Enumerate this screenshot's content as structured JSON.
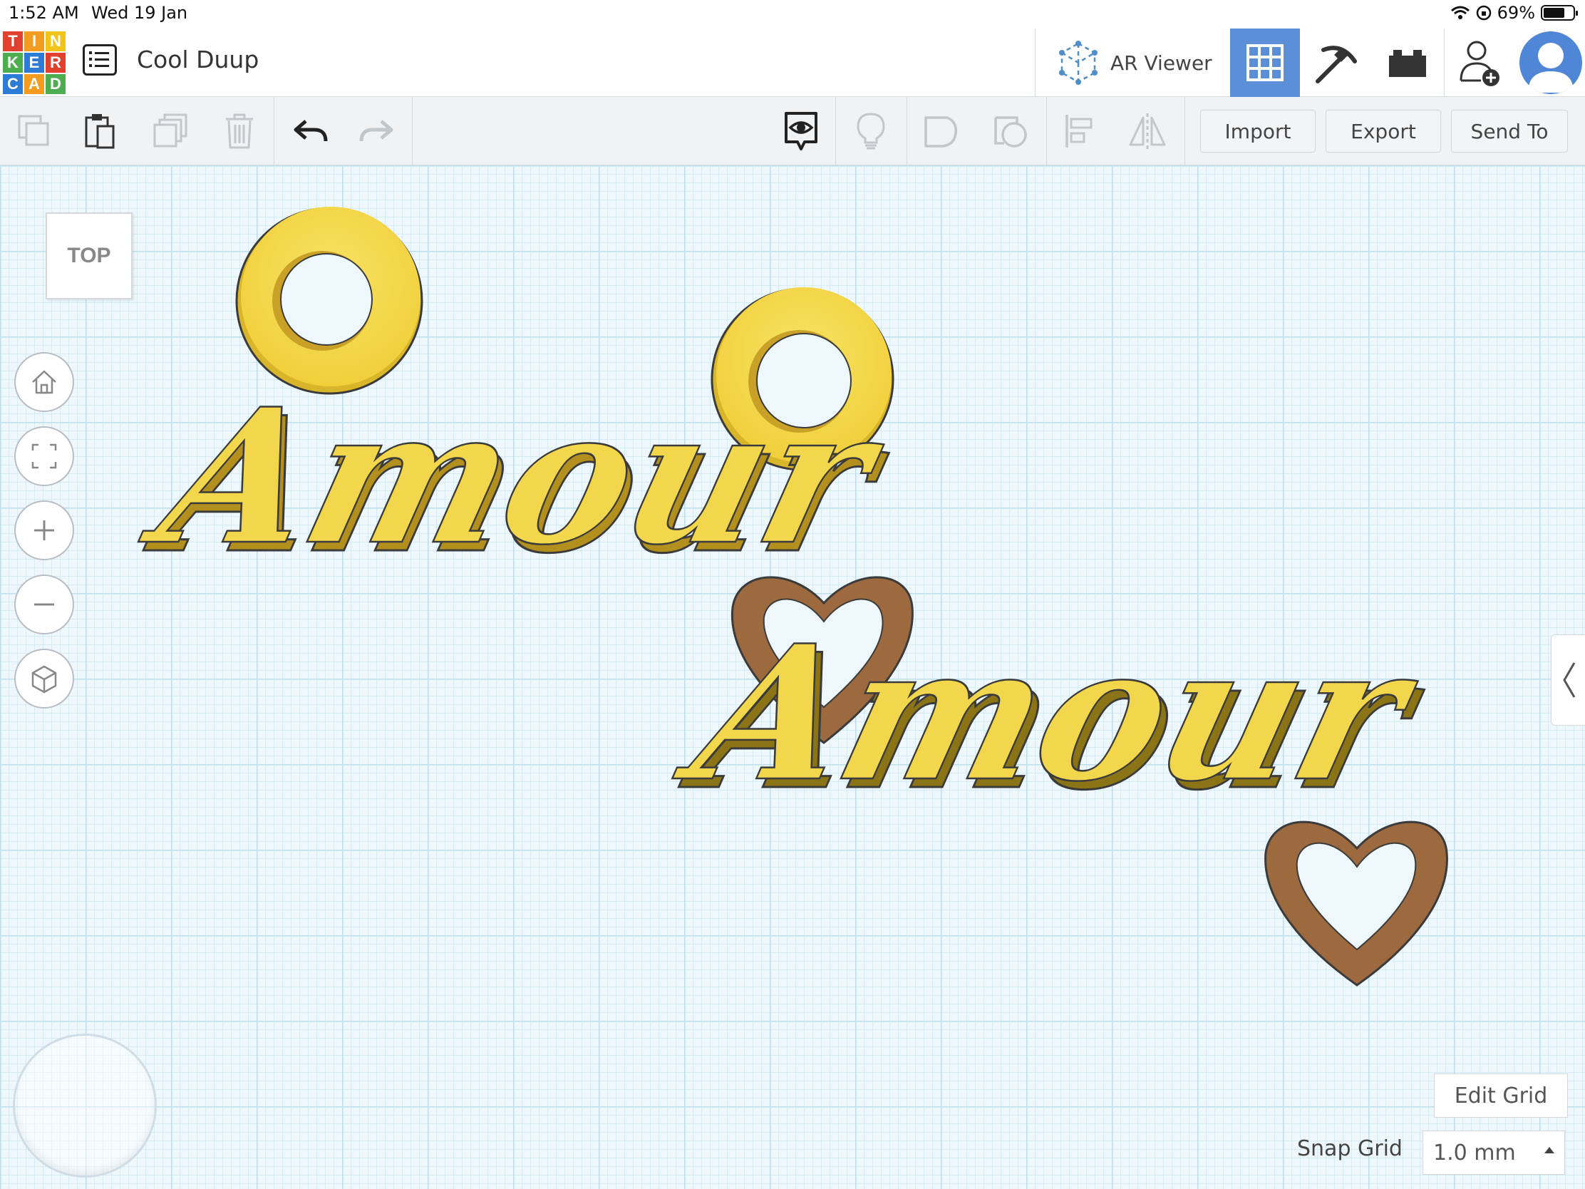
{
  "status_bar": {
    "time": "1:52 AM",
    "date": "Wed 19 Jan",
    "battery": "69%"
  },
  "logo": {
    "letters": [
      "T",
      "I",
      "N",
      "K",
      "E",
      "R",
      "C",
      "A",
      "D"
    ],
    "colors": [
      "#e2402f",
      "#f39c1f",
      "#f0c419",
      "#4cae4f",
      "#2c7bd6",
      "#e2402f",
      "#2c7bd6",
      "#f39c1f",
      "#4cae4f"
    ]
  },
  "header": {
    "title": "Cool Duup",
    "ar_viewer_label": "AR Viewer"
  },
  "toolbar": {
    "import_label": "Import",
    "export_label": "Export",
    "send_to_label": "Send To"
  },
  "canvas": {
    "view_label": "TOP",
    "text_object_1": "Amour",
    "text_object_2": "Amour",
    "edit_grid_label": "Edit Grid",
    "snap_grid_label": "Snap Grid",
    "snap_grid_value": "1.0 mm"
  },
  "colors": {
    "accent": "#5b8fd8",
    "object_yellow": "#f2d64b",
    "object_brown": "#9c6a3e"
  }
}
